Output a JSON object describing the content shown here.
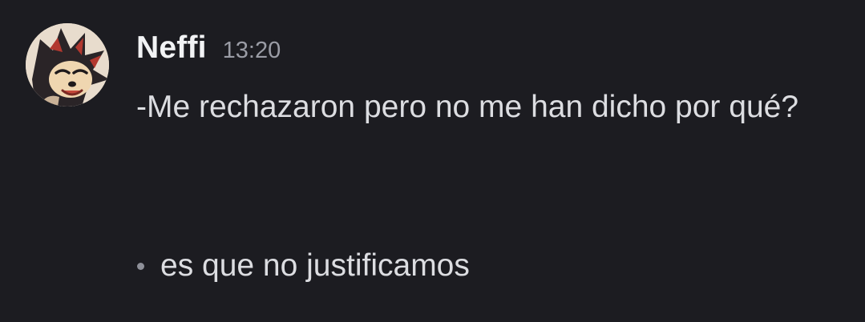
{
  "message": {
    "author": "Neffi",
    "timestamp": "13:20",
    "paragraph": "-Me rechazaron pero no me han dicho por qué?",
    "list_items": [
      "es que no justificamos"
    ]
  },
  "colors": {
    "background": "#1c1c21",
    "username": "#f2f3f5",
    "timestamp": "#9a9ca5",
    "text": "#dcdde1",
    "bullet": "#8e9099"
  },
  "icons": {
    "avatar": "shadow-hedgehog-avatar-icon",
    "bullet": "bullet-dot-icon"
  }
}
